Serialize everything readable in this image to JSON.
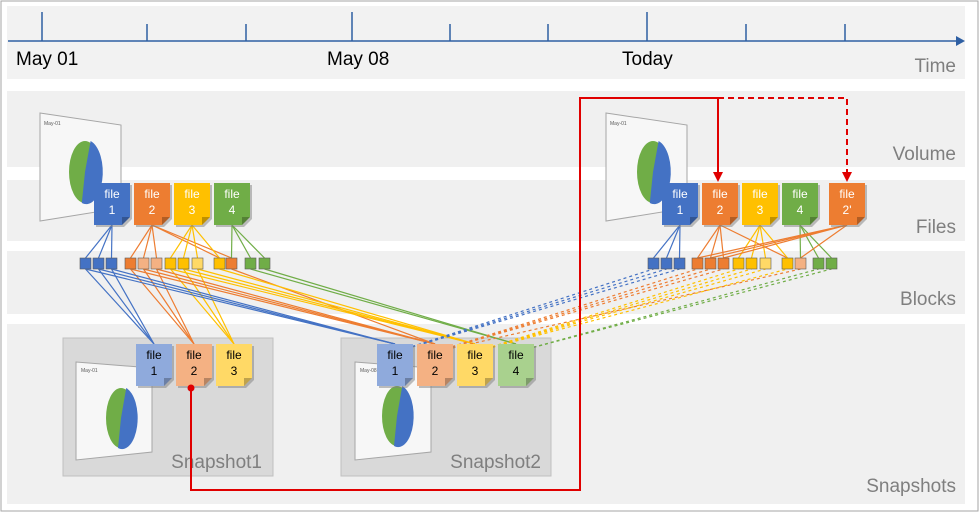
{
  "timeline": {
    "labels": [
      "May 01",
      "May 08",
      "Today"
    ],
    "axis_label": "Time"
  },
  "bands": {
    "volume": "Volume",
    "files": "Files",
    "blocks": "Blocks",
    "snapshots": "Snapshots"
  },
  "file_word": "file",
  "left_files": [
    "1",
    "2",
    "3",
    "4"
  ],
  "right_files": [
    "1",
    "2",
    "3",
    "4",
    "2'"
  ],
  "snapshot1": {
    "title": "Snapshot1",
    "files": [
      "1",
      "2",
      "3"
    ]
  },
  "snapshot2": {
    "title": "Snapshot2",
    "files": [
      "1",
      "2",
      "3",
      "4"
    ]
  },
  "chart_thumbnail": {
    "title": "May-01"
  },
  "chart_thumbnail_2": {
    "title": "May-08"
  },
  "colors": {
    "file1": "#4472c4",
    "file2": "#ed7d31",
    "file3": "#ffc000",
    "file4": "#70ad47",
    "file1_light": "#8faadc",
    "file2_light": "#f4b183",
    "file3_light": "#ffd966",
    "file4_light": "#a9d18e",
    "band": "#efefef",
    "axis": "#2e5fa3",
    "connector": "#e00000",
    "label_gray": "#7f7f7f"
  }
}
